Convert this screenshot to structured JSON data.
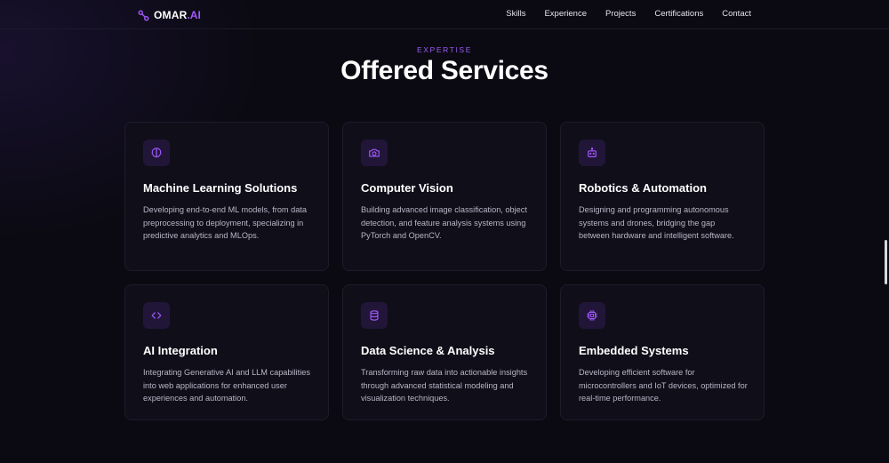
{
  "brand": {
    "name": "OMAR",
    "accent": ".AI",
    "icon": "brand-link-icon",
    "accent_color": "#a259ff"
  },
  "nav": {
    "links": [
      {
        "label": "Skills"
      },
      {
        "label": "Experience"
      },
      {
        "label": "Projects"
      },
      {
        "label": "Certifications"
      },
      {
        "label": "Contact"
      }
    ]
  },
  "section": {
    "eyebrow": "EXPERTISE",
    "title": "Offered Services"
  },
  "services": [
    {
      "icon": "brain-icon",
      "title": "Machine Learning Solutions",
      "description": "Developing end-to-end ML models, from data preprocessing to deployment, specializing in predictive analytics and MLOps."
    },
    {
      "icon": "camera-icon",
      "title": "Computer Vision",
      "description": "Building advanced image classification, object detection, and feature analysis systems using PyTorch and OpenCV."
    },
    {
      "icon": "robot-icon",
      "title": "Robotics & Automation",
      "description": "Designing and programming autonomous systems and drones, bridging the gap between hardware and intelligent software."
    },
    {
      "icon": "code-icon",
      "title": "AI Integration",
      "description": "Integrating Generative AI and LLM capabilities into web applications for enhanced user experiences and automation."
    },
    {
      "icon": "database-icon",
      "title": "Data Science & Analysis",
      "description": "Transforming raw data into actionable insights through advanced statistical modeling and visualization techniques."
    },
    {
      "icon": "cpu-chip-icon",
      "title": "Embedded Systems",
      "description": "Developing efficient software for microcontrollers and IoT devices, optimized for real-time performance."
    }
  ],
  "colors": {
    "background": "#0b0a12",
    "card": "#100e19",
    "accent": "#9b5cf6",
    "icon_bg": "#211638"
  }
}
